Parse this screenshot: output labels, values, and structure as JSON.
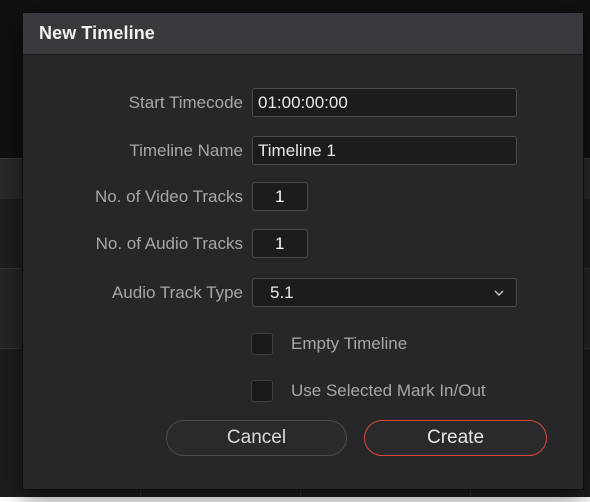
{
  "dialog": {
    "title": "New Timeline"
  },
  "fields": {
    "start_timecode": {
      "label": "Start Timecode",
      "value": "01:00:00:00"
    },
    "timeline_name": {
      "label": "Timeline Name",
      "value": "Timeline 1"
    },
    "video_tracks": {
      "label": "No. of Video Tracks",
      "value": "1"
    },
    "audio_tracks": {
      "label": "No. of Audio Tracks",
      "value": "1"
    },
    "audio_track_type": {
      "label": "Audio Track Type",
      "value": "5.1"
    }
  },
  "checkboxes": {
    "empty_timeline": {
      "label": "Empty Timeline",
      "checked": false
    },
    "use_selected_mark": {
      "label": "Use Selected Mark In/Out",
      "checked": false
    }
  },
  "buttons": {
    "cancel": "Cancel",
    "create": "Create"
  },
  "colors": {
    "accent_create": "#d8473a",
    "dialog_bg": "#27272a",
    "header_bg": "#39393d"
  },
  "icons": {
    "dropdown": "chevron-down-icon"
  }
}
